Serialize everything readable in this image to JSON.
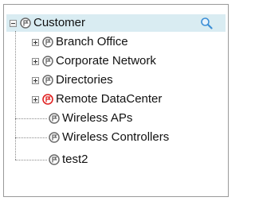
{
  "tree": {
    "root": {
      "label": "Customer",
      "expanded": true,
      "icon": "flag-icon"
    },
    "search_icon": "magnifier-icon",
    "children": [
      {
        "label": "Branch Office",
        "expandable": true,
        "icon": "flag-icon",
        "status": "normal"
      },
      {
        "label": "Corporate Network",
        "expandable": true,
        "icon": "flag-icon",
        "status": "normal"
      },
      {
        "label": "Directories",
        "expandable": true,
        "icon": "flag-icon",
        "status": "normal"
      },
      {
        "label": "Remote DataCenter",
        "expandable": true,
        "icon": "flag-icon",
        "status": "alert"
      },
      {
        "label": "Wireless APs",
        "expandable": false,
        "icon": "flag-icon",
        "status": "normal"
      },
      {
        "label": "Wireless Controllers",
        "expandable": false,
        "icon": "flag-icon",
        "status": "normal"
      },
      {
        "label": "test2",
        "expandable": false,
        "icon": "flag-icon",
        "status": "normal"
      }
    ]
  },
  "colors": {
    "selection_bg": "#d9ecf2",
    "icon_normal": "#6b6b6b",
    "icon_alert": "#e02020",
    "search_icon": "#3d8fd6"
  }
}
